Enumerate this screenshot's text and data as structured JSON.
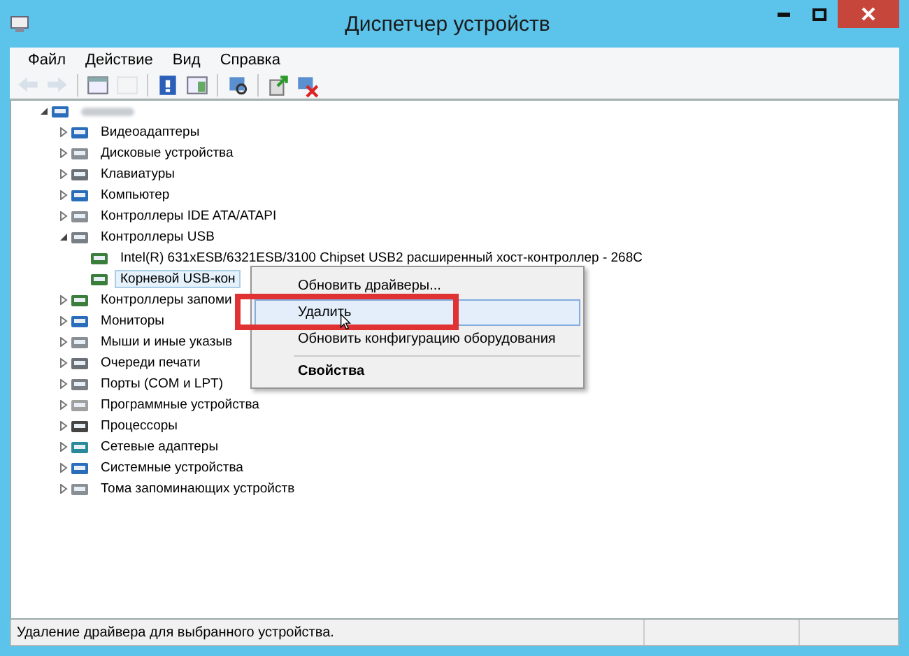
{
  "window": {
    "title": "Диспетчер устройств"
  },
  "menu": [
    "Файл",
    "Действие",
    "Вид",
    "Справка"
  ],
  "toolbar": [
    {
      "kind": "back",
      "disabled": true
    },
    {
      "kind": "forward",
      "disabled": true
    },
    {
      "kind": "sep"
    },
    {
      "kind": "console",
      "disabled": false
    },
    {
      "kind": "props",
      "disabled": true
    },
    {
      "kind": "sep"
    },
    {
      "kind": "help",
      "disabled": false
    },
    {
      "kind": "pane",
      "disabled": false
    },
    {
      "kind": "sep"
    },
    {
      "kind": "scan",
      "disabled": false
    },
    {
      "kind": "sep"
    },
    {
      "kind": "update",
      "disabled": false
    },
    {
      "kind": "uninstall",
      "disabled": false
    }
  ],
  "tree": {
    "expanded": true,
    "selected": false,
    "children": [
      {
        "label": "Видеоадаптеры",
        "expanded": false,
        "selected": false
      },
      {
        "label": "Дисковые устройства",
        "expanded": false,
        "selected": false
      },
      {
        "label": "Клавиатуры",
        "expanded": false,
        "selected": false
      },
      {
        "label": "Компьютер",
        "expanded": false,
        "selected": false
      },
      {
        "label": "Контроллеры IDE ATA/ATAPI",
        "expanded": false,
        "selected": false
      },
      {
        "label": "Контроллеры USB",
        "expanded": true,
        "selected": false,
        "children": [
          {
            "label": "Intel(R) 631xESB/6321ESB/3100 Chipset USB2 расширенный хост-контроллер  - 268C",
            "selected": false
          },
          {
            "label": "Корневой USB-кон",
            "selected": true
          }
        ]
      },
      {
        "label": "Контроллеры запоми",
        "expanded": false,
        "selected": false
      },
      {
        "label": "Мониторы",
        "expanded": false,
        "selected": false
      },
      {
        "label": "Мыши и иные указыв",
        "expanded": false,
        "selected": false
      },
      {
        "label": "Очереди печати",
        "expanded": false,
        "selected": false
      },
      {
        "label": "Порты (COM и LPT)",
        "expanded": false,
        "selected": false
      },
      {
        "label": "Программные устройства",
        "expanded": false,
        "selected": false
      },
      {
        "label": "Процессоры",
        "expanded": false,
        "selected": false
      },
      {
        "label": "Сетевые адаптеры",
        "expanded": false,
        "selected": false
      },
      {
        "label": "Системные устройства",
        "expanded": false,
        "selected": false
      },
      {
        "label": "Тома запоминающих устройств",
        "expanded": false,
        "selected": false
      }
    ]
  },
  "context_menu": [
    {
      "kind": "item",
      "label": "Обновить драйверы...",
      "selected": false,
      "bold": false
    },
    {
      "kind": "item",
      "label": "Удалить",
      "selected": true,
      "bold": false
    },
    {
      "kind": "item",
      "label": "Обновить конфигурацию оборудования",
      "selected": false,
      "bold": false
    },
    {
      "kind": "separator"
    },
    {
      "kind": "item",
      "label": "Свойства",
      "selected": false,
      "bold": true
    }
  ],
  "status_bar": [
    "Удаление драйвера для выбранного устройства."
  ]
}
